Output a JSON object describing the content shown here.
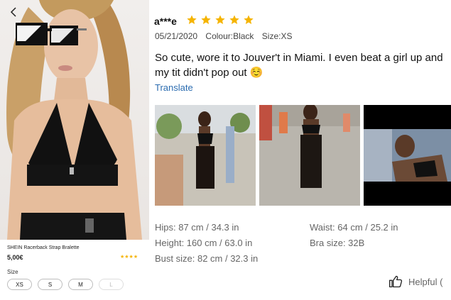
{
  "product": {
    "title": "SHEIN Racerback  Strap Bralette",
    "price": "5,00€",
    "stars": "★★★★",
    "size_label": "Size",
    "sizes": [
      {
        "label": "XS",
        "available": true
      },
      {
        "label": "S",
        "available": true
      },
      {
        "label": "M",
        "available": true
      },
      {
        "label": "L",
        "available": false
      }
    ]
  },
  "review": {
    "reviewer": "a***e",
    "rating": 5,
    "date": "05/21/2020",
    "color": "Colour:Black",
    "size": "Size:XS",
    "text": "So cute, wore it to Jouver't in Miami. I even beat a girl up and my tit didn't pop out ☺️",
    "translate_label": "Translate",
    "photo_count": 3,
    "measurements": {
      "hips": "Hips: 87 cm / 34.3 in",
      "waist": "Waist: 64 cm / 25.2 in",
      "height": "Height: 160 cm / 63.0 in",
      "bra": "Bra size: 32B",
      "bust": "Bust size: 82 cm / 32.3 in"
    },
    "helpful_label": "Helpful  ("
  },
  "colors": {
    "star": "#f5b400",
    "link": "#2b6cb0",
    "muted_text": "#666666"
  },
  "icons": [
    "back-arrow-icon",
    "star-icon",
    "thumbs-up-icon"
  ]
}
